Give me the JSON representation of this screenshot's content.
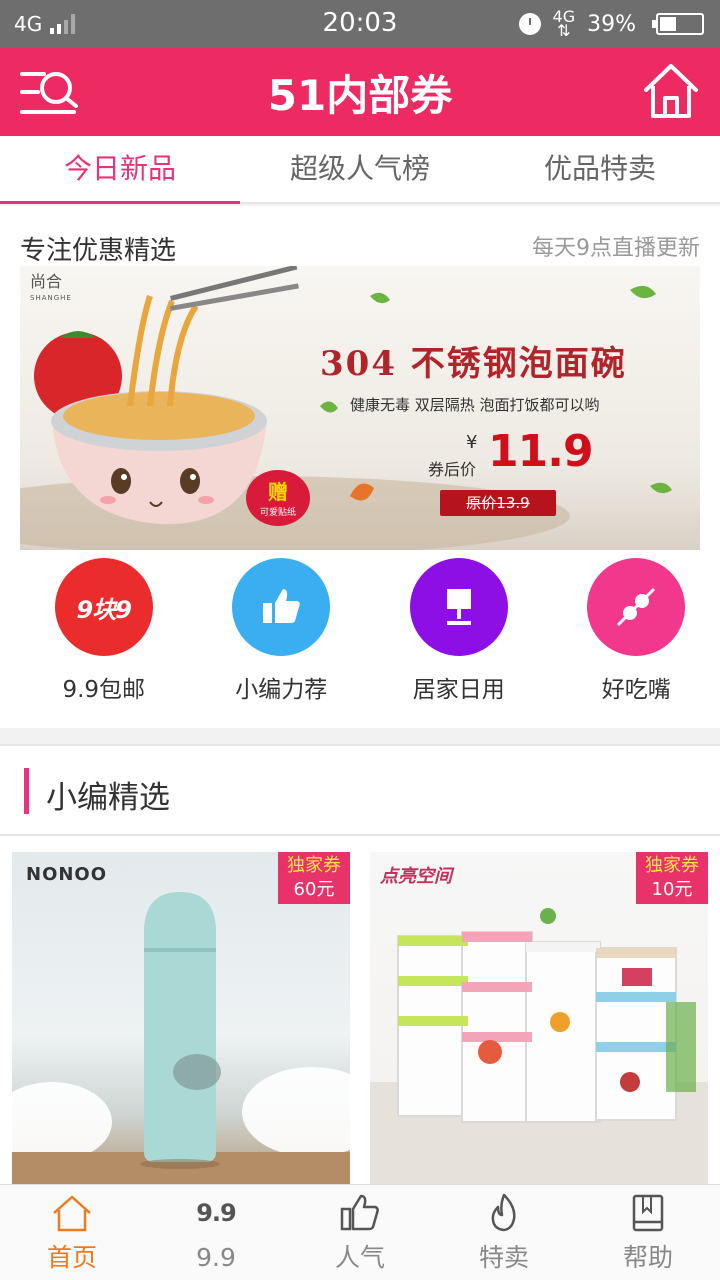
{
  "status_bar": {
    "network": "4G",
    "time": "20:03",
    "network_right": "4G",
    "battery": "39%",
    "battery_level": 0.39
  },
  "header": {
    "title": "51内部券",
    "menu_icon": "menu-search-icon",
    "home_icon": "home-icon",
    "color": "#ee2a63"
  },
  "tabs": [
    {
      "label": "今日新品",
      "active": true
    },
    {
      "label": "超级人气榜",
      "active": false
    },
    {
      "label": "优品特卖",
      "active": false
    }
  ],
  "featured": {
    "title": "专注优惠精选",
    "subtitle": "每天9点直播更新",
    "banner": {
      "brand": "尚合",
      "brand_en": "SHANGHE",
      "headline": "304 不锈钢泡面碗",
      "desc": "健康无毒  双层隔热  泡面打饭都可以哟",
      "yen": "¥",
      "after_coupon": "券后价",
      "price": "11.9",
      "original": "原价13.9",
      "gift_title": "赠",
      "gift_text": "可爱贴纸"
    }
  },
  "categories": [
    {
      "label": "9.9包邮",
      "icon": "9kuai9-icon",
      "icon_text": "9块9",
      "color": "#ea2c2c"
    },
    {
      "label": "小编力荐",
      "icon": "thumbs-up-icon",
      "color": "#3aaef0"
    },
    {
      "label": "居家日用",
      "icon": "lamp-icon",
      "color": "#8e0fe6"
    },
    {
      "label": "好吃嘴",
      "icon": "food-skewer-icon",
      "color": "#f2388c"
    }
  ],
  "picks": {
    "title": "小编精选",
    "products": [
      {
        "brand": "NONOO",
        "coupon_label": "独家券",
        "coupon_amount": "60元"
      },
      {
        "brand": "点亮空间",
        "coupon_label": "独家券",
        "coupon_amount": "10元"
      }
    ]
  },
  "bottom_nav": [
    {
      "label": "首页",
      "icon": "home-icon",
      "active": true
    },
    {
      "label": "9.9",
      "icon": "nine-nine-icon",
      "icon_text": "9.9",
      "active": false
    },
    {
      "label": "人气",
      "icon": "thumbs-up-icon",
      "active": false
    },
    {
      "label": "特卖",
      "icon": "flame-icon",
      "active": false
    },
    {
      "label": "帮助",
      "icon": "book-icon",
      "active": false
    }
  ]
}
